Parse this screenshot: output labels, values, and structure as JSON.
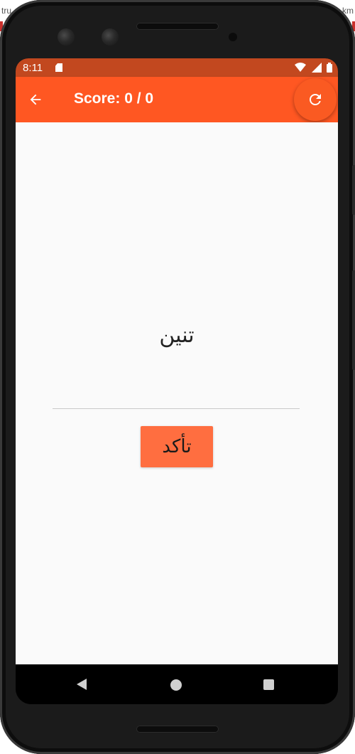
{
  "background": {
    "left_fragment": "tru",
    "right_fragment": "km"
  },
  "status_bar": {
    "time": "8:11",
    "icons": [
      "sd-card-icon",
      "wifi-icon",
      "signal-icon",
      "battery-icon"
    ],
    "color": "#c2481f"
  },
  "app_bar": {
    "title": "Score: 0 / 0",
    "back_icon": "arrow-back-icon",
    "refresh_icon": "refresh-icon",
    "color": "#ff5722"
  },
  "main": {
    "word": "تنين",
    "answer_value": "",
    "confirm_label": "تأكد",
    "button_color": "#ff6e40"
  },
  "nav_bar": {
    "icons": [
      "nav-back-icon",
      "nav-home-icon",
      "nav-recent-icon"
    ]
  }
}
